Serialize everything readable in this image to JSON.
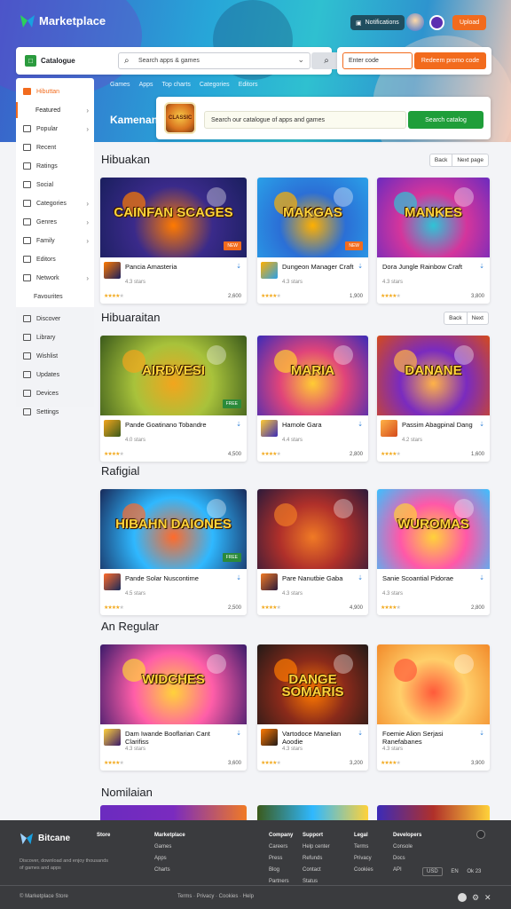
{
  "header": {
    "app_name": "Marketplace",
    "pill_label": "Notifications",
    "cta_label": "Upload"
  },
  "search": {
    "brand_label": "Catalogue",
    "placeholder": "Search apps & games",
    "promo_value": "Enter code",
    "promo_button": "Redeem promo code"
  },
  "subnav": [
    "Games",
    "Apps",
    "Top charts",
    "Categories",
    "Editors"
  ],
  "hero": {
    "title": "Kamenan",
    "banner_icon_label": "CLASSIC",
    "banner_input": "Search our catalogue of apps and games",
    "banner_button": "Search catalog"
  },
  "sidebar": {
    "items": [
      {
        "label": "Hibuttan",
        "icon": "home-icon",
        "arrow": false,
        "active": true
      },
      {
        "label": "Featured",
        "icon": "",
        "arrow": true,
        "sub": true,
        "selected": true
      },
      {
        "label": "Popular",
        "icon": "star-icon",
        "arrow": true
      },
      {
        "label": "Recent",
        "icon": "clock-icon",
        "arrow": false
      },
      {
        "label": "Ratings",
        "icon": "chart-icon",
        "arrow": false
      },
      {
        "label": "Social",
        "icon": "people-icon",
        "arrow": false
      },
      {
        "label": "Categories",
        "icon": "grid-icon",
        "arrow": true
      },
      {
        "label": "Genres",
        "icon": "tag-icon",
        "arrow": true
      },
      {
        "label": "Family",
        "icon": "heart-icon",
        "arrow": true
      },
      {
        "label": "Editors",
        "icon": "pen-icon",
        "arrow": false
      },
      {
        "label": "Network",
        "icon": "globe-icon",
        "arrow": true
      },
      {
        "label": "Favourites",
        "icon": "",
        "arrow": false,
        "sub": true
      }
    ],
    "section2": [
      {
        "label": "Discover",
        "icon": "compass-icon"
      },
      {
        "label": "Library",
        "icon": "book-icon"
      },
      {
        "label": "Wishlist",
        "icon": "list-icon"
      },
      {
        "label": "Updates",
        "icon": "refresh-icon"
      },
      {
        "label": "Devices",
        "icon": "device-icon"
      },
      {
        "label": "Settings",
        "icon": "gear-icon"
      }
    ]
  },
  "sections": [
    {
      "title": "Hibuakan",
      "controls": [
        "Back",
        "Next page"
      ],
      "cards": [
        {
          "art_title": "CAINFAN SCAGES",
          "tag": "NEW",
          "title": "Pancia Amasteria",
          "sub": "4.3 stars",
          "rating": 4,
          "count": "2,600"
        },
        {
          "art_title": "MAKGAS",
          "tag": "NEW",
          "title": "Dungeon Manager Craft",
          "sub": "4.3 stars",
          "rating": 4,
          "count": "1,900"
        },
        {
          "art_title": "MANKES",
          "tag": "",
          "title": "Dora Jungle Rainbow Craft",
          "sub": "4.3 stars",
          "rating": 4,
          "count": "3,800"
        }
      ]
    },
    {
      "title": "Hibuaraitan",
      "controls": [
        "Back",
        "Next"
      ],
      "cards": [
        {
          "art_title": "AIRDVESI",
          "tag": "FREE",
          "title": "Pande Goatinano Tobandre",
          "sub": "4.0 stars",
          "rating": 4,
          "count": "4,500"
        },
        {
          "art_title": "MARIA",
          "tag": "",
          "title": "Hamole Gara",
          "sub": "4.4 stars",
          "rating": 4,
          "count": "2,800"
        },
        {
          "art_title": "DANANE",
          "tag": "",
          "title": "Passim Abagpinal Dang",
          "sub": "4.2 stars",
          "rating": 4,
          "count": "1,600"
        }
      ]
    },
    {
      "title": "Rafigial",
      "controls": [],
      "cards": [
        {
          "art_title": "HIBAHN DAIONES",
          "tag": "FREE",
          "title": "Pande Solar Nuscontime",
          "sub": "4.5 stars",
          "rating": 4,
          "count": "2,500"
        },
        {
          "art_title": "",
          "tag": "",
          "title": "Pare Nanutbie Gaba",
          "sub": "4.3 stars",
          "rating": 4,
          "count": "4,900"
        },
        {
          "art_title": "WUROMAS",
          "tag": "",
          "title": "Sanie Scoantial Pidorae",
          "sub": "4.3 stars",
          "rating": 4,
          "count": "2,800"
        }
      ]
    },
    {
      "title": "An Regular",
      "controls": [],
      "cards": [
        {
          "art_title": "WIDCHES",
          "tag": "",
          "title": "Dam Iwande Booflarian Cant Clarifiss",
          "sub": "4.3 stars",
          "rating": 4,
          "count": "3,600"
        },
        {
          "art_title": "DANGE SOMARIS",
          "tag": "",
          "title": "Vartodoce Manelian Aoodie",
          "sub": "4.3 stars",
          "rating": 4,
          "count": "3,200"
        },
        {
          "art_title": "",
          "tag": "",
          "title": "Foemie Alion Serjasi Ranefabanes",
          "sub": "4.3 stars",
          "rating": 4,
          "count": "3,900"
        }
      ]
    },
    {
      "title": "Nomilaian",
      "controls": [],
      "cards": []
    }
  ],
  "footer": {
    "brand": "Bitcane",
    "description": "Discover, download and enjoy thousands of games and apps",
    "columns": [
      {
        "head": "Store",
        "items": []
      },
      {
        "head": "Marketplace",
        "items": [
          "Games",
          "Apps",
          "Charts"
        ]
      },
      {
        "head": "Company",
        "items": [
          "Careers",
          "Press",
          "Blog",
          "Partners"
        ]
      },
      {
        "head": "Support",
        "items": [
          "Help center",
          "Refunds",
          "Contact",
          "Status"
        ]
      },
      {
        "head": "Legal",
        "items": [
          "Terms",
          "Privacy",
          "Cookies"
        ]
      },
      {
        "head": "Developers",
        "items": [
          "Console",
          "Docs",
          "API"
        ]
      }
    ],
    "badges": [
      "USD",
      "EN",
      "Ok 23"
    ],
    "bottom_left": "© Marketplace Store",
    "bottom_links": "Terms · Privacy · Cookies · Help"
  },
  "colors": {
    "accent": "#f26b1d",
    "green": "#1f9e3a",
    "star": "#f2a91d"
  }
}
